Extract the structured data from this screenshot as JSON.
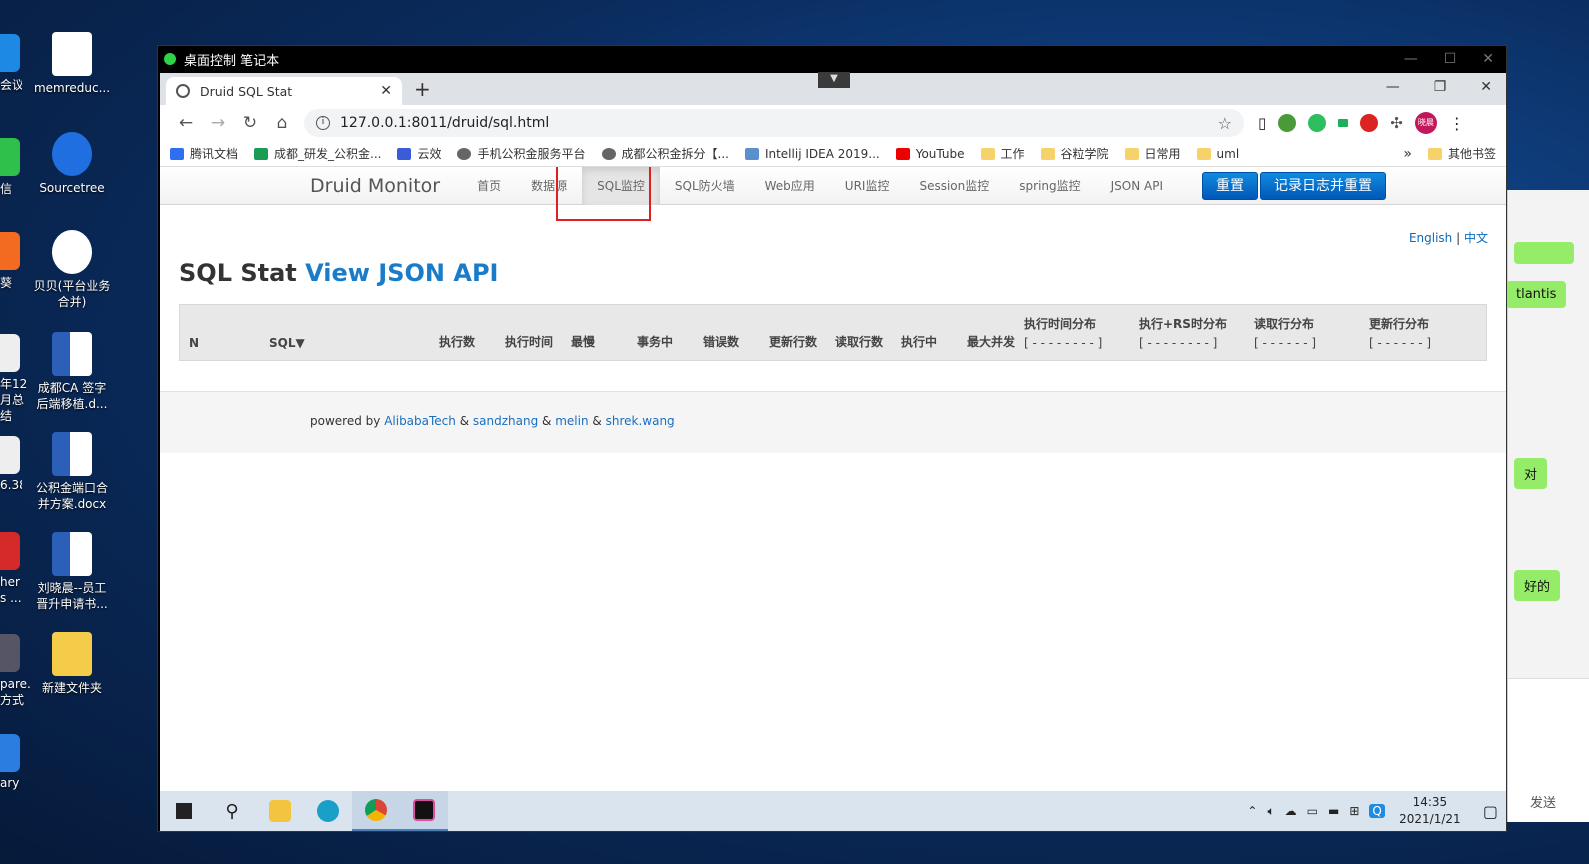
{
  "desktop": {
    "icons": [
      {
        "label": "memreduc..."
      },
      {
        "label": "Sourcetree"
      },
      {
        "label": "贝贝(平台业务合并)"
      },
      {
        "label": "成都CA 签字后端移植.d..."
      },
      {
        "label": "公积金端口合并方案.docx"
      },
      {
        "label": "刘晓晨--员工晋升申请书..."
      },
      {
        "label": "新建文件夹"
      }
    ],
    "left_peek": [
      "会议",
      "信",
      "葵",
      "年12月总结",
      "6.38",
      "her s ...",
      "pare... 方式",
      "ary"
    ]
  },
  "remote_window": {
    "title": "桌面控制 笔记本"
  },
  "browser": {
    "tab_title": "Druid SQL Stat",
    "url": "127.0.0.1:8011/druid/sql.html",
    "bookmarks": [
      "腾讯文档",
      "成都_研发_公积金...",
      "云效",
      "手机公积金服务平台",
      "成都公积金拆分【...",
      "Intellij IDEA 2019...",
      "YouTube",
      "工作",
      "谷粒学院",
      "日常用",
      "uml"
    ],
    "bookmarks_more": "»",
    "other_bookmarks": "其他书签",
    "ext_badge": "晓晨"
  },
  "page": {
    "brand": "Druid Monitor",
    "nav": [
      "首页",
      "数据源",
      "SQL监控",
      "SQL防火墙",
      "Web应用",
      "URI监控",
      "Session监控",
      "spring监控",
      "JSON API"
    ],
    "active_nav": "SQL监控",
    "btn_reset": "重置",
    "btn_log_reset": "记录日志并重置",
    "lang_en": "English",
    "lang_sep": "|",
    "lang_zh": "中文",
    "title": "SQL Stat",
    "title_link": "View JSON API",
    "table": {
      "columns": [
        "N",
        "SQL▼",
        "执行数",
        "执行时间",
        "最慢",
        "事务中",
        "错误数",
        "更新行数",
        "读取行数",
        "执行中",
        "最大并发"
      ],
      "dist_columns": [
        {
          "title": "执行时间分布",
          "range": "[ - - - - - - - - ]"
        },
        {
          "title": "执行+RS时分布",
          "range": "[ - - - - - - - - ]"
        },
        {
          "title": "读取行分布",
          "range": "[ - - - - - - ]"
        },
        {
          "title": "更新行分布",
          "range": "[ - - - - - - ]"
        }
      ]
    },
    "footer": {
      "prefix": "powered by",
      "links": [
        "AlibabaTech",
        "sandzhang",
        "melin",
        "shrek.wang"
      ],
      "sep": "&"
    }
  },
  "taskbar": {
    "time": "14:35",
    "date": "2021/1/21"
  },
  "chat_peek": {
    "messages": [
      "tlantis",
      "对",
      "好的"
    ],
    "send": "发送"
  }
}
